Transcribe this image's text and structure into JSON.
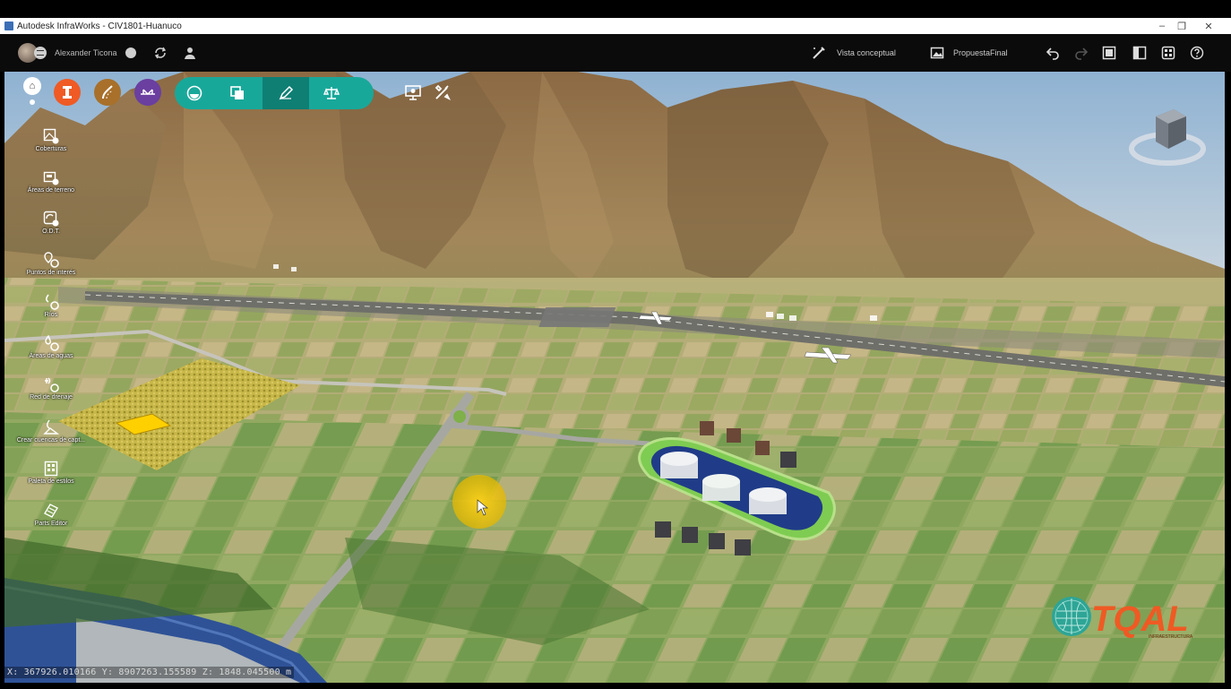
{
  "window": {
    "title": "Autodesk InfraWorks - CIV1801-Huanuco",
    "min": "–",
    "restore": "❐",
    "close": "✕"
  },
  "user": {
    "name": "Alexander Ticona"
  },
  "header": {
    "style_label": "Vista conceptual",
    "proposal_label": "PropuestaFinal"
  },
  "icons": {
    "home": "home-icon",
    "settings": "gear-icon",
    "undo": "undo-icon",
    "redo": "redo-icon",
    "help": "help-icon"
  },
  "sidebar": {
    "items": [
      {
        "label": "Coberturas"
      },
      {
        "label": "Áreas de terreno"
      },
      {
        "label": "O.D.T."
      },
      {
        "label": "Puntos de interés"
      },
      {
        "label": "Ríos"
      },
      {
        "label": "Áreas de aguas"
      },
      {
        "label": "Red de drenaje"
      },
      {
        "label": "Crear cuencas de capt..."
      },
      {
        "label": "Paleta de estilos"
      },
      {
        "label": "Parts Editor"
      }
    ]
  },
  "status": {
    "coords": "X: 367926.010166 Y: 8907263.155589 Z: 1848.045500 m"
  },
  "logo": {
    "text": "TQAL",
    "subtext": "INFRAESTRUCTURA"
  },
  "colors": {
    "accent": "#18a89a",
    "orange": "#f05a24",
    "brown": "#a8702a",
    "purple": "#6a3fa0",
    "water": "#2d4f9a"
  }
}
